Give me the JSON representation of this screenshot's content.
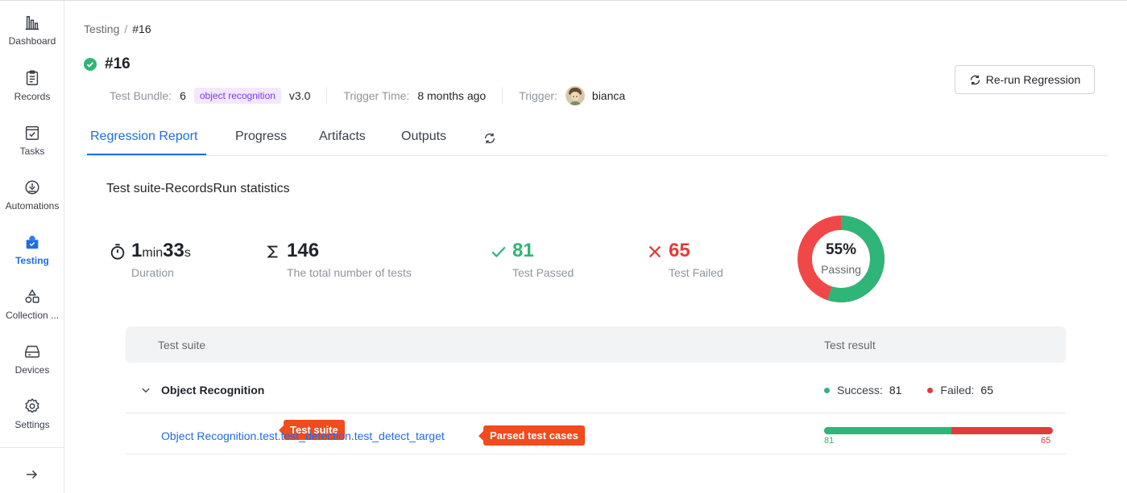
{
  "sidebar": {
    "items": [
      {
        "label": "Dashboard",
        "icon": "bar-chart-icon"
      },
      {
        "label": "Records",
        "icon": "clipboard-icon"
      },
      {
        "label": "Tasks",
        "icon": "task-icon"
      },
      {
        "label": "Automations",
        "icon": "automation-icon"
      },
      {
        "label": "Testing",
        "icon": "testing-icon",
        "active": true
      },
      {
        "label": "Collection ...",
        "icon": "collection-icon"
      },
      {
        "label": "Devices",
        "icon": "device-icon"
      },
      {
        "label": "Settings",
        "icon": "gear-icon"
      }
    ],
    "expand_icon": "arrow-right-icon"
  },
  "breadcrumb": {
    "parent": "Testing",
    "separator": "/",
    "current": "#16"
  },
  "header": {
    "title": "#16",
    "status_icon": "check-circle-icon",
    "test_bundle_label": "Test Bundle:",
    "test_bundle_value": "6",
    "bundle_tag": "object recognition",
    "bundle_version": "v3.0",
    "trigger_time_label": "Trigger Time:",
    "trigger_time_value": "8 months ago",
    "trigger_label": "Trigger:",
    "trigger_user": "bianca",
    "rerun_label": "Re-run Regression"
  },
  "tabs": [
    {
      "label": "Regression Report",
      "active": true
    },
    {
      "label": "Progress"
    },
    {
      "label": "Artifacts"
    },
    {
      "label": "Outputs"
    }
  ],
  "statistics": {
    "title": "Test suite-RecordsRun statistics",
    "duration": {
      "min": "1",
      "min_unit": "min",
      "sec": "33",
      "sec_unit": "s",
      "label": "Duration"
    },
    "total": {
      "value": "146",
      "label": "The total number of tests"
    },
    "passed": {
      "value": "81",
      "label": "Test Passed"
    },
    "failed": {
      "value": "65",
      "label": "Test Failed"
    },
    "passing": {
      "percent_text": "55%",
      "label": "Passing",
      "fraction": 0.55
    }
  },
  "table": {
    "headers": {
      "suite": "Test suite",
      "result": "Test result"
    },
    "suite": {
      "name": "Object Recognition",
      "callout": "Test suite",
      "success_label": "Success:",
      "success_value": "81",
      "failed_label": "Failed:",
      "failed_value": "65"
    },
    "case": {
      "name": "Object Recognition.test.test_detection.test_detect_target",
      "callout": "Parsed test cases",
      "pass": "81",
      "fail": "65",
      "pass_fraction": 0.555
    }
  },
  "colors": {
    "accent": "#1e6ce8",
    "success": "#2fb577",
    "failure": "#e33b3b",
    "callout": "#f24b1c",
    "tag_bg": "#f3e8ff",
    "tag_fg": "#7c3aed"
  }
}
